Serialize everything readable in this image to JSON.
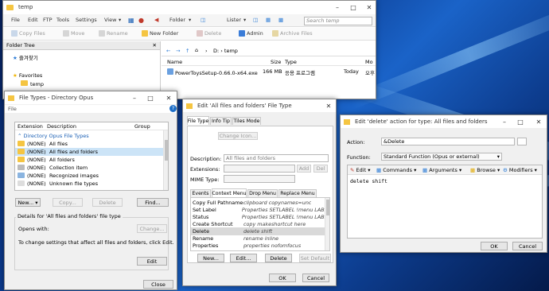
{
  "main": {
    "title": "temp",
    "menu": [
      "File",
      "Edit",
      "FTP",
      "Tools",
      "Settings",
      "View"
    ],
    "toolbar1": {
      "folder": "Folder",
      "lister": "Lister",
      "search_placeholder": "Search temp"
    },
    "toolbar2": [
      "Copy Files",
      "Move",
      "Rename",
      "New Folder",
      "Delete",
      "Admin",
      "Archive Files"
    ],
    "tree_title": "Folder Tree",
    "tree_items": [
      "즐겨찾기",
      "Favorites",
      "temp"
    ],
    "path": "D:  › temp",
    "columns": [
      "Name",
      "Size",
      "Type",
      "Mo"
    ],
    "file": {
      "name": "PowerToysSetup-0.66.0-x64.exe",
      "size": "166 MB",
      "type": "응용 프로그램",
      "modified": "Today",
      "extra": "오후"
    }
  },
  "filetypes": {
    "title": "File Types - Directory Opus",
    "menu_file": "File",
    "cols": [
      "Extension",
      "Description",
      "Group"
    ],
    "group_header": "Directory Opus File Types",
    "rows": [
      {
        "ext": "(NONE)",
        "desc": "All files"
      },
      {
        "ext": "(NONE)",
        "desc": "All files and folders"
      },
      {
        "ext": "(NONE)",
        "desc": "All folders"
      },
      {
        "ext": "(NONE)",
        "desc": "Collection item"
      },
      {
        "ext": "(NONE)",
        "desc": "Recognized images"
      },
      {
        "ext": "(NONE)",
        "desc": "Unknown file types"
      }
    ],
    "btn_new": "New...",
    "btn_copy": "Copy...",
    "btn_delete": "Delete",
    "btn_find": "Find...",
    "details_label": "Details for 'All files and folders' file type",
    "opens_with": "Opens with:",
    "change": "Change...",
    "help_text": "To change settings that affect all files and folders, click Edit.",
    "edit": "Edit",
    "close": "Close"
  },
  "editft": {
    "title": "Edit 'All files and folders' File Type",
    "tabs": [
      "File Type",
      "Info Tip",
      "Tiles Mode"
    ],
    "change_icon": "Change Icon...",
    "description_label": "Description:",
    "description_value": "All files and folders",
    "extensions_label": "Extensions:",
    "add": "Add",
    "del": "Del",
    "mime_label": "MIME Type:",
    "subtabs": [
      "Events",
      "Context Menu",
      "Drop Menu",
      "Replace Menu"
    ],
    "items": [
      {
        "name": "Copy Full Pathnames",
        "cmd": "clipboard copynames=unc"
      },
      {
        "name": "Set Label",
        "cmd": "Properties SETLABEL !menu LABE..."
      },
      {
        "name": "Status",
        "cmd": "Properties SETLABEL !menu LABE..."
      },
      {
        "name": "Create Shortcut",
        "cmd": "copy makeshortcut here"
      },
      {
        "name": "Delete",
        "cmd": "delete shift"
      },
      {
        "name": "Rename",
        "cmd": "rename inline"
      },
      {
        "name": "Properties",
        "cmd": "properties nofomfocus"
      }
    ],
    "new": "New...",
    "edit": "Edit...",
    "delete": "Delete",
    "set_default": "Set Default",
    "ok": "OK",
    "cancel": "Cancel"
  },
  "action": {
    "title": "Edit 'delete' action for type: All files and folders",
    "action_label": "Action:",
    "action_value": "&Delete",
    "function_label": "Function:",
    "function_value": "Standard Function (Opus or external)",
    "toolbar": [
      "Edit",
      "Commands",
      "Arguments",
      "Browse",
      "Modifiers"
    ],
    "code": "delete shift",
    "ok": "OK",
    "cancel": "Cancel"
  }
}
